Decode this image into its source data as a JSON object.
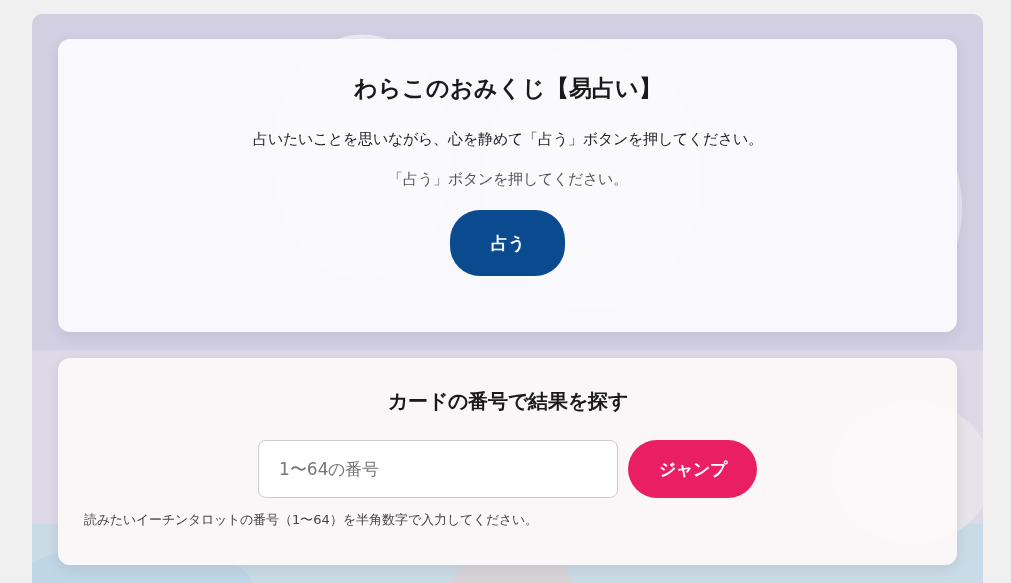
{
  "omikuji": {
    "title": "わらこのおみくじ【易占い】",
    "instruction": "占いたいことを思いながら、心を静めて「占う」ボタンを押してください。",
    "status": "「占う」ボタンを押してください。",
    "button": "占う"
  },
  "search": {
    "title": "カードの番号で結果を探す",
    "placeholder": "1〜64の番号",
    "button": "ジャンプ",
    "hint": "読みたいイーチンタロットの番号（1〜64）を半角数字で入力してください。"
  }
}
